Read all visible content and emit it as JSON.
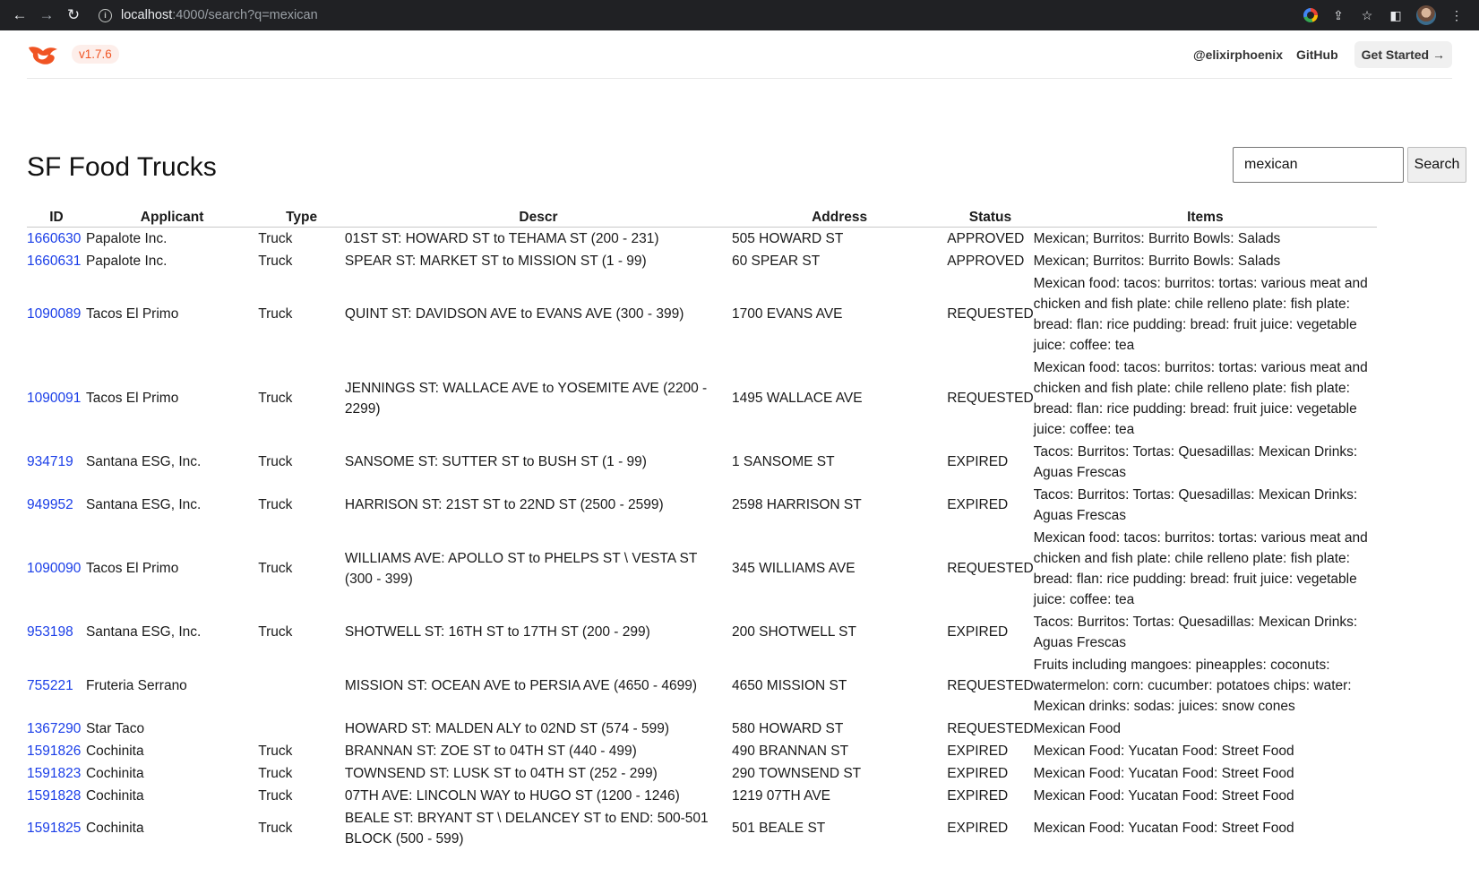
{
  "browser": {
    "url_host": "localhost",
    "url_rest": ":4000/search?q=mexican"
  },
  "header": {
    "version": "v1.7.6",
    "links": [
      "@elixirphoenix",
      "GitHub"
    ],
    "get_started": "Get Started →"
  },
  "page": {
    "title": "SF Food Trucks"
  },
  "search": {
    "value": "mexican",
    "button": "Search"
  },
  "table": {
    "headers": [
      "ID",
      "Applicant",
      "Type",
      "Descr",
      "Address",
      "Status",
      "Items"
    ],
    "rows": [
      [
        "1660630",
        "Papalote Inc.",
        "Truck",
        "01ST ST: HOWARD ST to TEHAMA ST (200 - 231)",
        "505 HOWARD ST",
        "APPROVED",
        "Mexican; Burritos: Burrito Bowls: Salads"
      ],
      [
        "1660631",
        "Papalote Inc.",
        "Truck",
        "SPEAR ST: MARKET ST to MISSION ST (1 - 99)",
        "60 SPEAR ST",
        "APPROVED",
        "Mexican; Burritos: Burrito Bowls: Salads"
      ],
      [
        "1090089",
        "Tacos El Primo",
        "Truck",
        "QUINT ST: DAVIDSON AVE to EVANS AVE (300 - 399)",
        "1700 EVANS AVE",
        "REQUESTED",
        "Mexican food: tacos: burritos: tortas: various meat and chicken and fish plate: chile relleno plate: fish plate: bread: flan: rice pudding: bread: fruit juice: vegetable juice: coffee: tea"
      ],
      [
        "1090091",
        "Tacos El Primo",
        "Truck",
        "JENNINGS ST: WALLACE AVE to YOSEMITE AVE (2200 - 2299)",
        "1495 WALLACE AVE",
        "REQUESTED",
        "Mexican food: tacos: burritos: tortas: various meat and chicken and fish plate: chile relleno plate: fish plate: bread: flan: rice pudding: bread: fruit juice: vegetable juice: coffee: tea"
      ],
      [
        "934719",
        "Santana ESG, Inc.",
        "Truck",
        "SANSOME ST: SUTTER ST to BUSH ST (1 - 99)",
        "1 SANSOME ST",
        "EXPIRED",
        "Tacos: Burritos: Tortas: Quesadillas: Mexican Drinks: Aguas Frescas"
      ],
      [
        "949952",
        "Santana ESG, Inc.",
        "Truck",
        "HARRISON ST: 21ST ST to 22ND ST (2500 - 2599)",
        "2598 HARRISON ST",
        "EXPIRED",
        "Tacos: Burritos: Tortas: Quesadillas: Mexican Drinks: Aguas Frescas"
      ],
      [
        "1090090",
        "Tacos El Primo",
        "Truck",
        "WILLIAMS AVE: APOLLO ST to PHELPS ST \\ VESTA ST (300 - 399)",
        "345 WILLIAMS AVE",
        "REQUESTED",
        "Mexican food: tacos: burritos: tortas: various meat and chicken and fish plate: chile relleno plate: fish plate: bread: flan: rice pudding: bread: fruit juice: vegetable juice: coffee: tea"
      ],
      [
        "953198",
        "Santana ESG, Inc.",
        "Truck",
        "SHOTWELL ST: 16TH ST to 17TH ST (200 - 299)",
        "200 SHOTWELL ST",
        "EXPIRED",
        "Tacos: Burritos: Tortas: Quesadillas: Mexican Drinks: Aguas Frescas"
      ],
      [
        "755221",
        "Fruteria Serrano",
        "",
        "MISSION ST: OCEAN AVE to PERSIA AVE (4650 - 4699)",
        "4650 MISSION ST",
        "REQUESTED",
        "Fruits including mangoes: pineapples: coconuts: watermelon: corn: cucumber: potatoes chips: water: Mexican drinks: sodas: juices: snow cones"
      ],
      [
        "1367290",
        "Star Taco",
        "",
        "HOWARD ST: MALDEN ALY to 02ND ST (574 - 599)",
        "580 HOWARD ST",
        "REQUESTED",
        "Mexican Food"
      ],
      [
        "1591826",
        "Cochinita",
        "Truck",
        "BRANNAN ST: ZOE ST to 04TH ST (440 - 499)",
        "490 BRANNAN ST",
        "EXPIRED",
        "Mexican Food: Yucatan Food: Street Food"
      ],
      [
        "1591823",
        "Cochinita",
        "Truck",
        "TOWNSEND ST: LUSK ST to 04TH ST (252 - 299)",
        "290 TOWNSEND ST",
        "EXPIRED",
        "Mexican Food: Yucatan Food: Street Food"
      ],
      [
        "1591828",
        "Cochinita",
        "Truck",
        "07TH AVE: LINCOLN WAY to HUGO ST (1200 - 1246)",
        "1219 07TH AVE",
        "EXPIRED",
        "Mexican Food: Yucatan Food: Street Food"
      ],
      [
        "1591825",
        "Cochinita",
        "Truck",
        "BEALE ST: BRYANT ST \\ DELANCEY ST to END: 500-501 BLOCK (500 - 599)",
        "501 BEALE ST",
        "EXPIRED",
        "Mexican Food: Yucatan Food: Street Food"
      ]
    ]
  }
}
